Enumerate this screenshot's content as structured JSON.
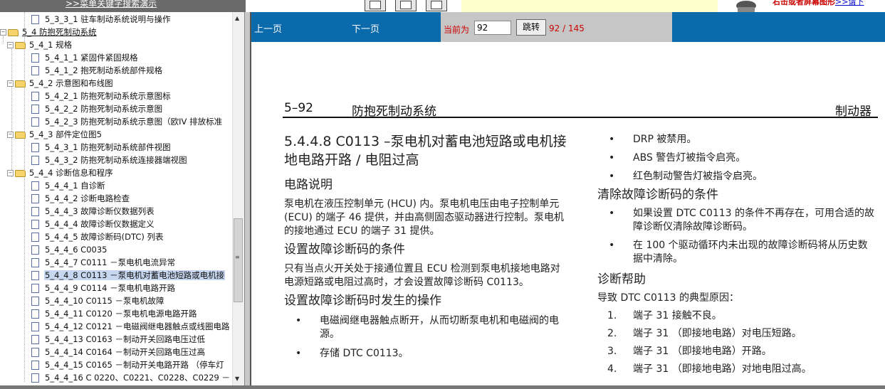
{
  "top": {
    "link": ">>菜单关键字搜索演示",
    "right_text": "右击或者屏幕图形",
    "right_link": ">>请下"
  },
  "tree": {
    "items": [
      {
        "label": "5_3_3_1 驻车制动系统说明与操作",
        "type": "doc",
        "level": 2
      },
      {
        "label": "5_4 防抱死制动系统",
        "type": "folder",
        "level": 0,
        "underline": true
      },
      {
        "label": "5_4_1 规格",
        "type": "folder",
        "level": 1
      },
      {
        "label": "5_4_1_1 紧固件紧固规格",
        "type": "doc",
        "level": 2
      },
      {
        "label": "5_4_1_2 抱死制动系统部件规格",
        "type": "doc",
        "level": 2
      },
      {
        "label": "5_4_2 示意图和布线图",
        "type": "folder",
        "level": 1
      },
      {
        "label": "5_4_2_1 防抱死制动系统示意图标",
        "type": "doc",
        "level": 2
      },
      {
        "label": "5_4_2_2 防抱死制动系统示意图",
        "type": "doc",
        "level": 2
      },
      {
        "label": "5_4_2_3 防抱死制动系统示意图（欧IV 排放标准",
        "type": "doc",
        "level": 2
      },
      {
        "label": "5_4_3 部件定位图5",
        "type": "folder",
        "level": 1
      },
      {
        "label": "5_4_3_1 防抱死制动系统部件视图",
        "type": "doc",
        "level": 2
      },
      {
        "label": "5_4_3_2 防抱死制动系统连接器端视图",
        "type": "doc",
        "level": 2
      },
      {
        "label": "5_4_4 诊断信息和程序",
        "type": "folder",
        "level": 1
      },
      {
        "label": "5_4_4_1 自诊断",
        "type": "doc",
        "level": 2
      },
      {
        "label": "5_4_4_2 诊断电路检查",
        "type": "doc",
        "level": 2
      },
      {
        "label": "5_4_4_3 故障诊断仪数据列表",
        "type": "doc",
        "level": 2
      },
      {
        "label": "5_4_4_4 故障诊断仪数据定义",
        "type": "doc",
        "level": 2
      },
      {
        "label": "5_4_4_5 故障诊断码(DTC) 列表",
        "type": "doc",
        "level": 2
      },
      {
        "label": "5_4_4_6 C0035",
        "type": "doc",
        "level": 2
      },
      {
        "label": "5_4_4_7 C0111 －泵电机电流异常",
        "type": "doc",
        "level": 2
      },
      {
        "label": "5_4_4_8 C0113 －泵电机对蓄电池短路或电机接",
        "type": "doc",
        "level": 2,
        "selected": true
      },
      {
        "label": "5_4_4_9 C0114 －泵电机电路开路",
        "type": "doc",
        "level": 2
      },
      {
        "label": "5_4_4_10 C0115 －泵电机故障",
        "type": "doc",
        "level": 2
      },
      {
        "label": "5_4_4_11 C0120 －泵电机电源电路开路",
        "type": "doc",
        "level": 2
      },
      {
        "label": "5_4_4_12 C0121 －电磁阀继电器触点或线圈电路",
        "type": "doc",
        "level": 2
      },
      {
        "label": "5_4_4_13 C0163 －制动开关回路电压过低",
        "type": "doc",
        "level": 2
      },
      {
        "label": "5_4_4_14 C0164 －制动开关回路电压过高",
        "type": "doc",
        "level": 2
      },
      {
        "label": "5_4_4_15 C0165 －制动开关电路开路 （停车灯",
        "type": "doc",
        "level": 2
      },
      {
        "label": "5_4_4_16 C 0220、C0221、C0228、C0229 －",
        "type": "doc",
        "level": 2
      }
    ]
  },
  "nav": {
    "prev": "上一页",
    "next": "下一页",
    "current_label": "当前为",
    "current_value": "92",
    "jump_button": "跳转",
    "count": "92 / 145"
  },
  "page": {
    "header_num": "5–92",
    "header_title": "防抱死制动系统",
    "header_right": "制动器",
    "title": "5.4.4.8 C0113 –泵电机对蓄电池短路或电机接地电路开路 / 电阻过高",
    "circuit_heading": "电路说明",
    "circuit_text": "泵电机在液压控制单元 (HCU) 内。泵电机电压由电子控制单元 (ECU) 的端子 46 提供，并由高侧固态驱动器进行控制。泵电机的接地通过 ECU 的端子 31 提供。",
    "set_heading": "设置故障诊断码的条件",
    "set_text": "只有当点火开关处于接通位置且 ECU 检测到泵电机接地电路对电源短路或电阻过高时，才会设置故障诊断码 C0113。",
    "action_heading": "设置故障诊断码时发生的操作",
    "action_items": [
      "电磁阀继电器触点断开，从而切断泵电机和电磁阀的电源。",
      "存储 DTC C0113。"
    ],
    "action_items_right": [
      "DRP 被禁用。",
      "ABS 警告灯被指令启亮。",
      "红色制动警告灯被指令启亮。"
    ],
    "clear_heading": "清除故障诊断码的条件",
    "clear_items": [
      "如果设置 DTC C0113 的条件不再存在，可用合适的故障诊断仪清除故障诊断码。",
      "在 100 个驱动循环内未出现的故障诊断码将从历史数据中清除。"
    ],
    "help_heading": "诊断帮助",
    "help_intro": "导致 DTC C0113 的典型原因：",
    "help_items": [
      "端子 31 接触不良。",
      "端子 31 （即接地电路）对电压短路。",
      "端子 31 （即接地电路）开路。",
      "端子 31 （即接地电路）对地电阻过高。"
    ]
  }
}
